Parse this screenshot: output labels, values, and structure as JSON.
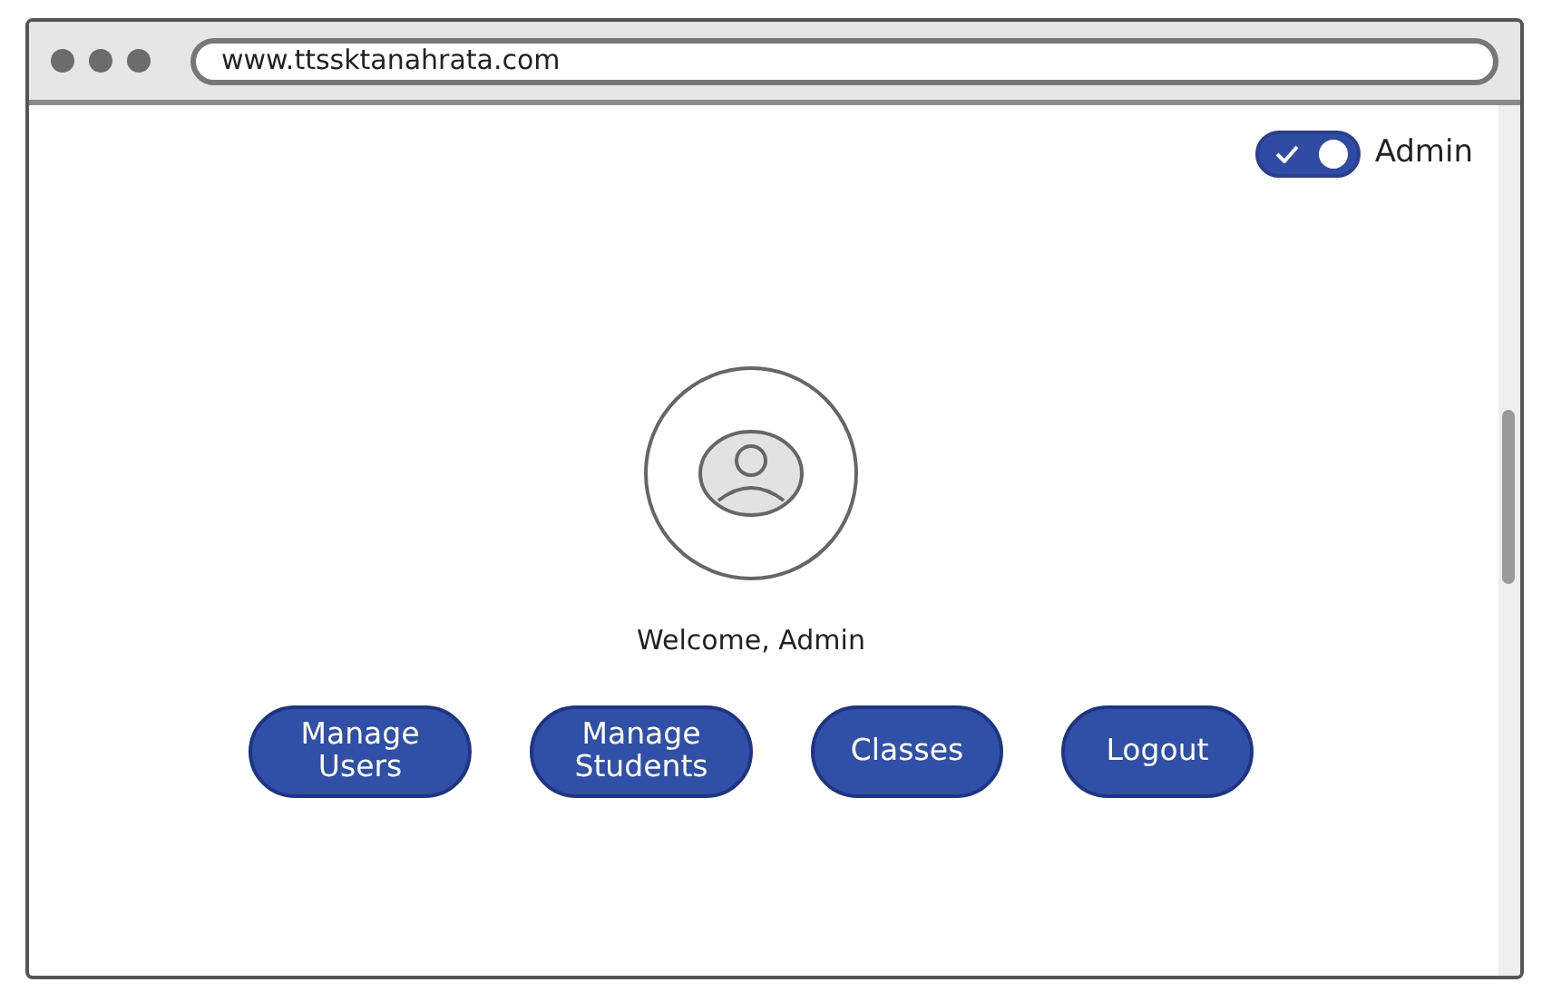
{
  "browser": {
    "url": "www.ttssktanahrata.com"
  },
  "role_toggle": {
    "label": "Admin",
    "checked": true
  },
  "welcome": "Welcome, Admin",
  "buttons": [
    {
      "label": "Manage Users"
    },
    {
      "label": "Manage Students"
    },
    {
      "label": "Classes"
    },
    {
      "label": "Logout"
    }
  ]
}
